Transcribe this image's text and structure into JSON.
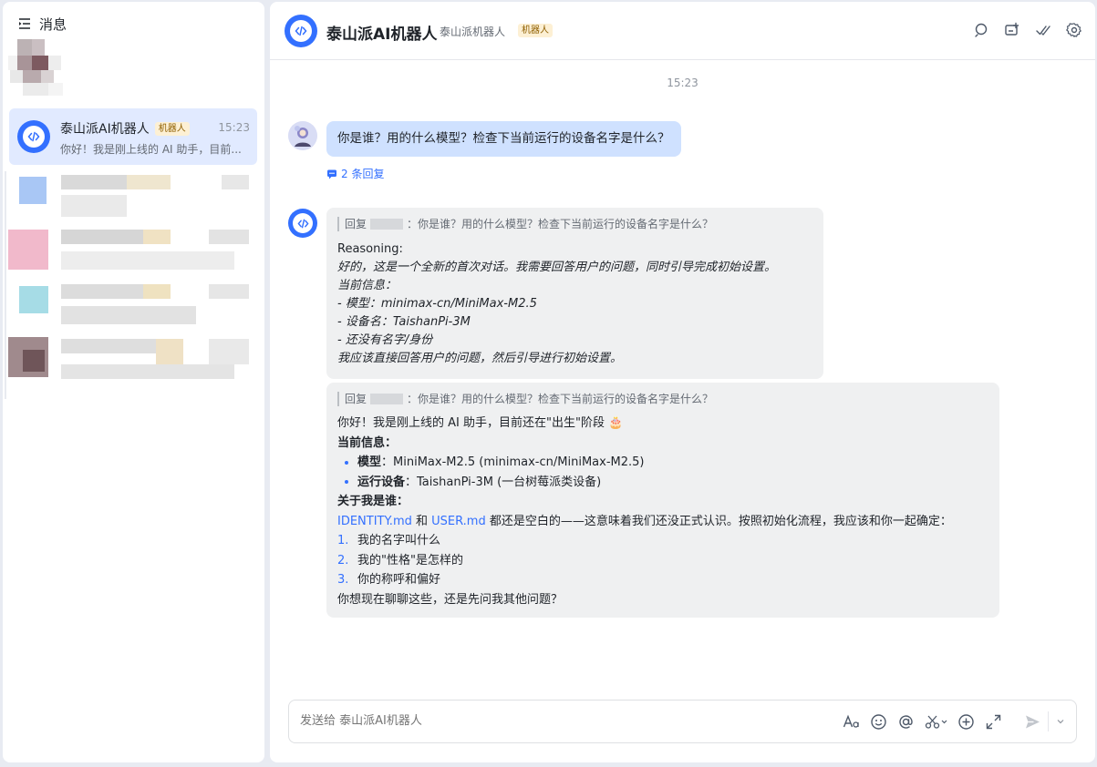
{
  "sidebar": {
    "title": "消息",
    "active_chat": {
      "name": "泰山派AI机器人",
      "badge": "机器人",
      "time": "15:23",
      "preview": "你好！我是刚上线的 AI 助手，目前..."
    }
  },
  "chat": {
    "title": "泰山派AI机器人",
    "subtitle": "泰山派机器人",
    "badge": "机器人",
    "timestamp": "15:23",
    "user_message": "你是谁？用的什么模型？检查下当前运行的设备名字是什么？",
    "reply_count": "2 条回复",
    "reply_one": {
      "quote_prefix": "回复",
      "quote_text": "：你是谁？用的什么模型？检查下当前运行的设备名字是什么？",
      "line1": "Reasoning:",
      "line2": "好的，这是一个全新的首次对话。我需要回答用户的问题，同时引导完成初始设置。",
      "line3": "当前信息：",
      "line4": "- 模型：minimax-cn/MiniMax-M2.5",
      "line5": "- 设备名：TaishanPi-3M",
      "line6": "- 还没有名字/身份",
      "line7": "我应该直接回答用户的问题，然后引导进行初始设置。"
    },
    "reply_two": {
      "quote_prefix": "回复",
      "quote_text": "：你是谁？用的什么模型？检查下当前运行的设备名字是什么？",
      "intro": "你好！我是刚上线的 AI 助手，目前还在\"出生\"阶段 🎂",
      "info_heading": "当前信息：",
      "model_label": "模型",
      "model_value": "：MiniMax-M2.5 (minimax-cn/MiniMax-M2.5)",
      "device_label": "运行设备",
      "device_value": "：TaishanPi-3M (一台树莓派类设备)",
      "about_heading": "关于我是谁：",
      "identity_link": "IDENTITY.md",
      "and_text": " 和 ",
      "user_link": "USER.md",
      "empty_text": " 都还是空白的——这意味着我们还没正式认识。按照初始化流程，我应该和你一起确定：",
      "items": [
        {
          "num": "1.",
          "text": "我的名字叫什么"
        },
        {
          "num": "2.",
          "text": "我的\"性格\"是怎样的"
        },
        {
          "num": "3.",
          "text": "你的称呼和偏好"
        }
      ],
      "closing": "你想现在聊聊这些，还是先问我其他问题？"
    },
    "composer_placeholder": "发送给 泰山派AI机器人"
  },
  "colors": {
    "accent": "#3370ff",
    "user_bubble": "#cfe1ff",
    "bot_bubble": "#eff0f1",
    "active_chat_bg": "#e1eaff"
  }
}
